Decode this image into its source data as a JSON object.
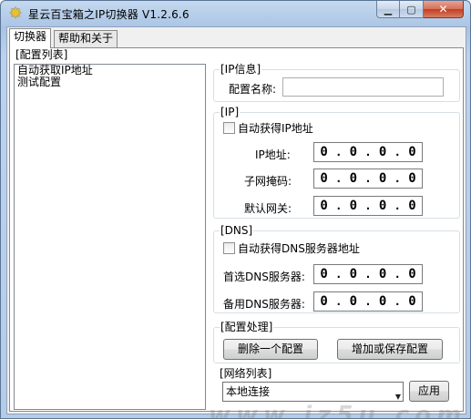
{
  "window": {
    "title": "星云百宝箱之IP切换器 V1.2.6.6",
    "icon": "star-app-icon",
    "controls": {
      "minimize": "minimize-icon",
      "maximize": "maximize-icon",
      "close": "close-icon"
    }
  },
  "tabs": [
    {
      "label": "切换器",
      "active": true
    },
    {
      "label": "帮助和关于",
      "active": false
    }
  ],
  "config_list": {
    "title": "[配置列表]",
    "items": [
      "自动获取IP地址",
      "测试配置"
    ]
  },
  "ip_info": {
    "title": "[IP信息]",
    "config_name_label": "配置名称:",
    "config_name_value": ""
  },
  "ip": {
    "title": "[IP]",
    "auto_label": "自动获得IP地址",
    "auto_checked": false,
    "address_label": "IP地址:",
    "address": [
      "0",
      "0",
      "0",
      "0"
    ],
    "mask_label": "子网掩码:",
    "mask": [
      "0",
      "0",
      "0",
      "0"
    ],
    "gateway_label": "默认网关:",
    "gateway": [
      "0",
      "0",
      "0",
      "0"
    ]
  },
  "dns": {
    "title": "[DNS]",
    "auto_label": "自动获得DNS服务器地址",
    "auto_checked": false,
    "primary_label": "首选DNS服务器:",
    "primary": [
      "0",
      "0",
      "0",
      "0"
    ],
    "secondary_label": "备用DNS服务器:",
    "secondary": [
      "0",
      "0",
      "0",
      "0"
    ]
  },
  "config_actions": {
    "title": "[配置处理]",
    "delete_label": "删除一个配置",
    "save_label": "增加或保存配置"
  },
  "network": {
    "title": "[网络列表]",
    "selected": "本地连接",
    "apply_label": "应用"
  },
  "watermark": "www.jz5u.com"
}
